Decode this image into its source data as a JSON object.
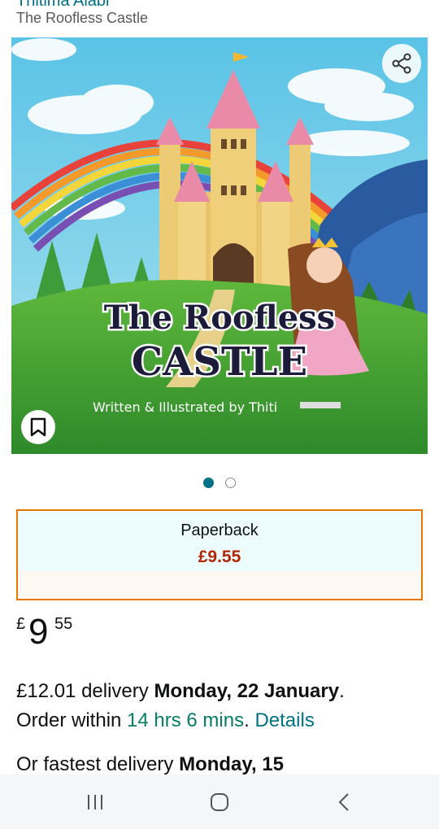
{
  "header": {
    "author_partial": "Thitima Alabi",
    "subtitle": "The Roofless Castle"
  },
  "cover": {
    "title_line1": "The Roofless",
    "title_line2": "CASTLE",
    "credit": "Written & Illustrated by Thiti",
    "icons": {
      "share": "share-icon",
      "save": "bookmark-icon"
    }
  },
  "carousel": {
    "count": 2,
    "active": 0
  },
  "format": {
    "name": "Paperback",
    "price": "£9.55"
  },
  "price": {
    "currency": "£",
    "whole": "9",
    "fraction": "55"
  },
  "delivery": {
    "cost": "£12.01 delivery",
    "date": "Monday, 22 January",
    "period": ".",
    "order_within_label": "Order within",
    "countdown": "14 hrs 6 mins",
    "details_link": "Details"
  },
  "fastest": {
    "label": "Or fastest delivery",
    "date": "Monday, 15"
  },
  "system_nav": {
    "recent": "recent-apps-icon",
    "home": "home-icon",
    "back": "back-icon"
  },
  "colors": {
    "link": "#007185",
    "price_red": "#b12704",
    "selected_border": "#e77600",
    "countdown_green": "#067d62"
  }
}
